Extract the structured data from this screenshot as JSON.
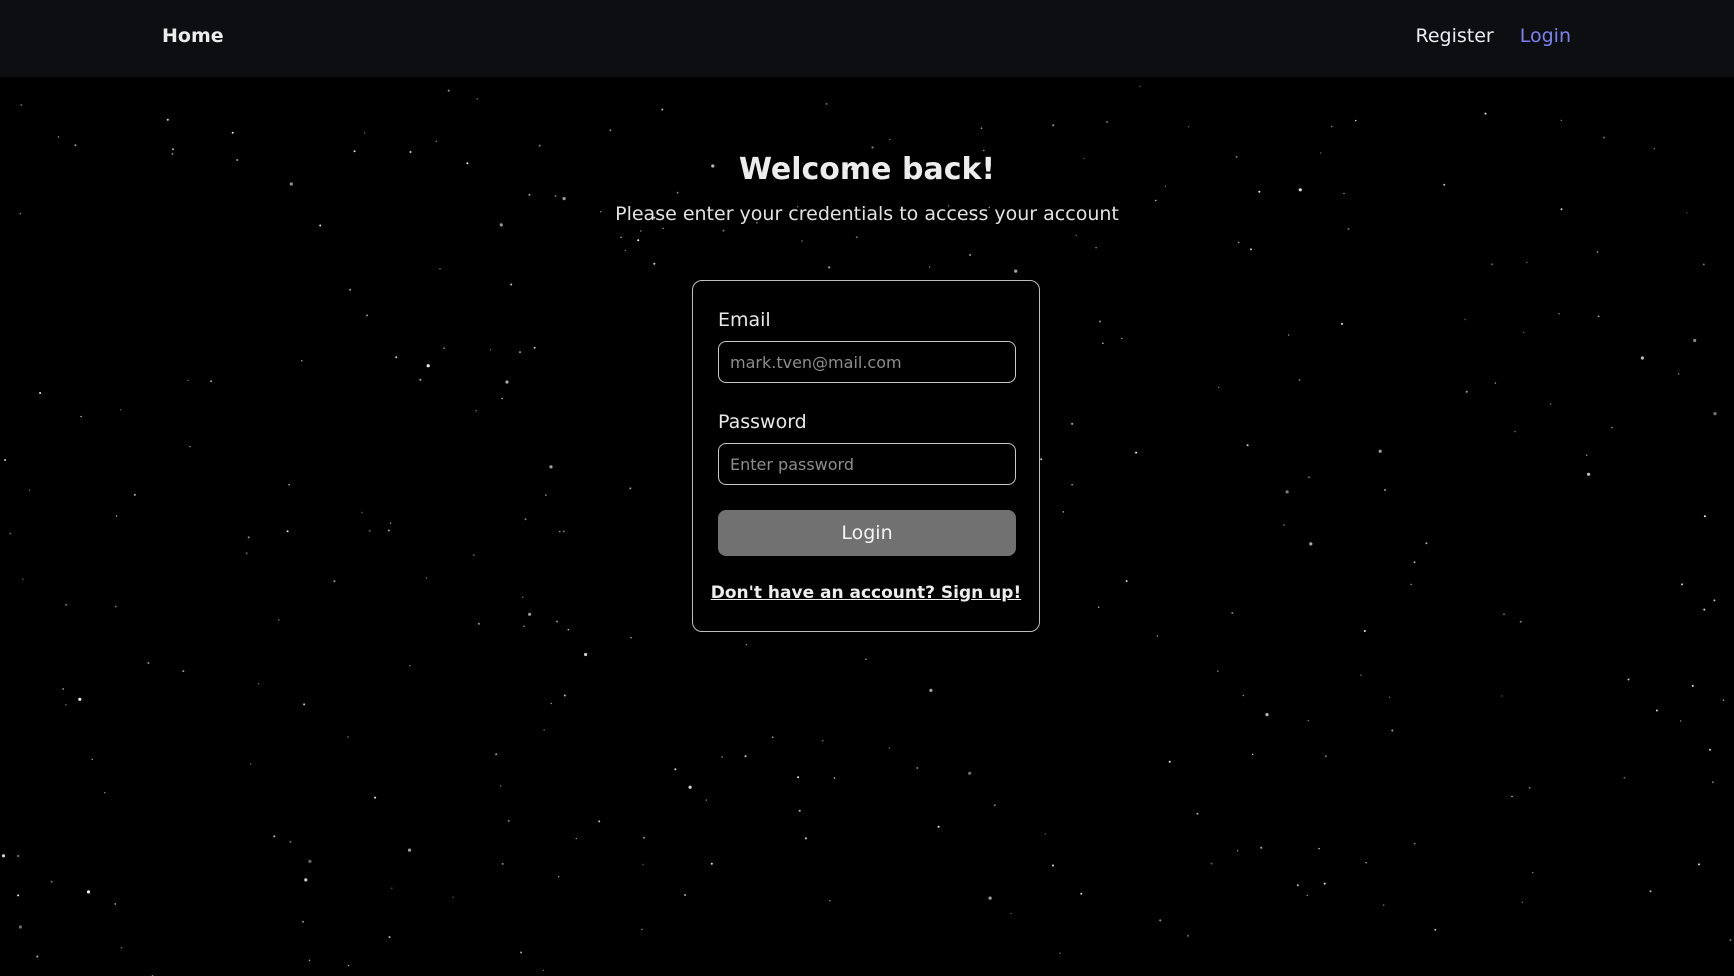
{
  "nav": {
    "home": "Home",
    "register": "Register",
    "login": "Login"
  },
  "hero": {
    "title": "Welcome back!",
    "subtitle": "Please enter your credentials to access your account"
  },
  "form": {
    "email_label": "Email",
    "email_placeholder": "mark.tven@mail.com",
    "email_value": "",
    "password_label": "Password",
    "password_placeholder": "Enter password",
    "password_value": "",
    "submit_label": "Login",
    "signup_text": "Don't have an account? Sign up!"
  },
  "colors": {
    "background": "#000000",
    "navbar": "#0d0e11",
    "active_link": "#7b82f0",
    "button": "#717171",
    "card_border": "#bdbdbd"
  }
}
